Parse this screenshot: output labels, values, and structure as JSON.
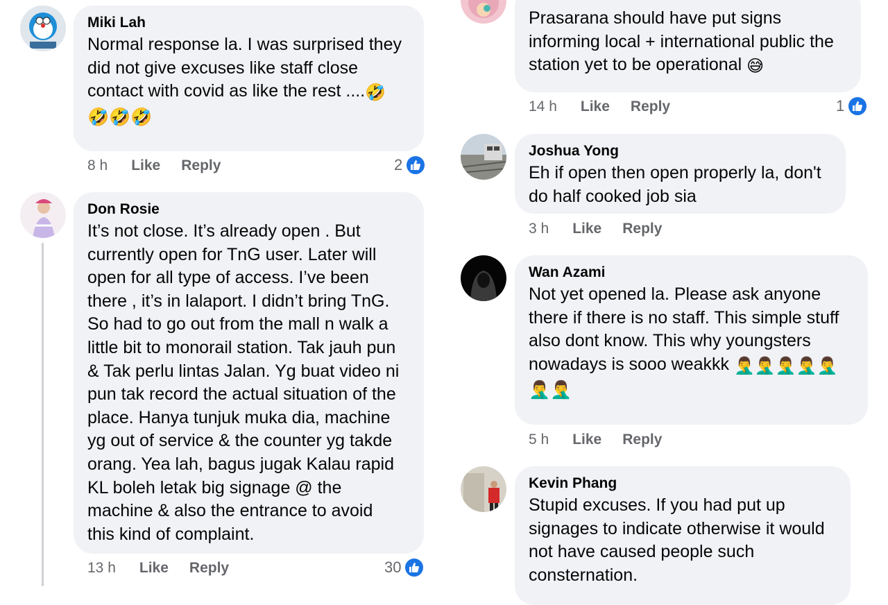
{
  "colors": {
    "bubble": "#f0f2f5",
    "meta": "#65676b",
    "like": "#1b74e4"
  },
  "left": {
    "c1": {
      "name": "Miki Lah",
      "text": "Normal response la. I was surprised they\ndid not give excuses like staff close\ncontact with covid as like the rest ....",
      "emojis": "🤣🤣🤣",
      "time": "8 h",
      "like": "Like",
      "reply": "Reply",
      "reactions": "2"
    },
    "c2": {
      "name": "Don Rosie",
      "text": "It’s not close. It’s already open . But\ncurrently open for TnG user. Later will\nopen for all type of access. I’ve been\nthere , it’s in lalaport. I didn’t  bring TnG.\nSo had to go out from the mall n walk a\nlittle bit to monorail station. Tak jauh pun\n& Tak perlu lintas Jalan. Yg buat video ni\npun tak record the actual situation of the\nplace. Hanya tunjuk muka dia, machine\nyg out of service & the counter yg takde\norang. Yea lah, bagus jugak Kalau rapid\nKL boleh letak big signage @ the\nmachine & also the entrance to avoid\nthis kind of complaint.",
      "time": "13 h",
      "like": "Like",
      "reply": "Reply",
      "reactions": "30"
    }
  },
  "right": {
    "c1": {
      "text": "Prasarana should have put signs\ninforming local + international public the\nstation yet to be operational",
      "emoji": "😅",
      "time": "14 h",
      "like": "Like",
      "reply": "Reply",
      "reactions": "1"
    },
    "c2": {
      "name": "Joshua Yong",
      "text": "Eh if open then open properly la, don't\ndo half cooked job sia",
      "time": "3 h",
      "like": "Like",
      "reply": "Reply"
    },
    "c3": {
      "name": "Wan Azami",
      "text": "Not yet opened la. Please ask anyone\nthere if there is no staff. This simple stuff\nalso dont know. This why youngsters\nnowadays is sooo weakkk",
      "emojis1": "🤦‍♂️🤦‍♂️🤦‍♂️🤦‍♂️🤦‍♂️",
      "emojis2": "🤦‍♂️🤦‍♂️",
      "time": "5 h",
      "like": "Like",
      "reply": "Reply"
    },
    "c4": {
      "name": "Kevin Phang",
      "text": "Stupid excuses. If you had put up\nsignages to indicate otherwise it would\nnot have caused people such\nconsternation."
    }
  }
}
